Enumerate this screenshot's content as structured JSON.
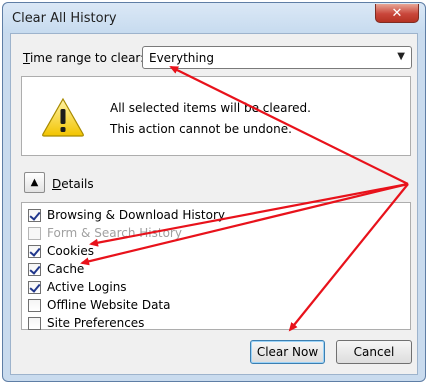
{
  "window": {
    "title": "Clear All History",
    "close_label": "✕"
  },
  "time_range": {
    "label_prefix": "T",
    "label_rest": "ime range to clear:",
    "value": "Everything"
  },
  "warning": {
    "icon": "warning-icon",
    "line1": "All selected items will be cleared.",
    "line2": "This action cannot be undone."
  },
  "details": {
    "label_prefix": "D",
    "label_rest": "etails",
    "toggle_glyph": "▲"
  },
  "items": [
    {
      "label": "Browsing & Download History",
      "checked": true,
      "enabled": true
    },
    {
      "label": "Form & Search History",
      "checked": false,
      "enabled": false
    },
    {
      "label": "Cookies",
      "checked": true,
      "enabled": true
    },
    {
      "label": "Cache",
      "checked": true,
      "enabled": true
    },
    {
      "label": "Active Logins",
      "checked": true,
      "enabled": true
    },
    {
      "label": "Offline Website Data",
      "checked": false,
      "enabled": true
    },
    {
      "label": "Site Preferences",
      "checked": false,
      "enabled": true
    }
  ],
  "buttons": {
    "clear_now": "Clear Now",
    "cancel": "Cancel"
  },
  "annotation": {
    "arrow_color": "#e8121b"
  }
}
